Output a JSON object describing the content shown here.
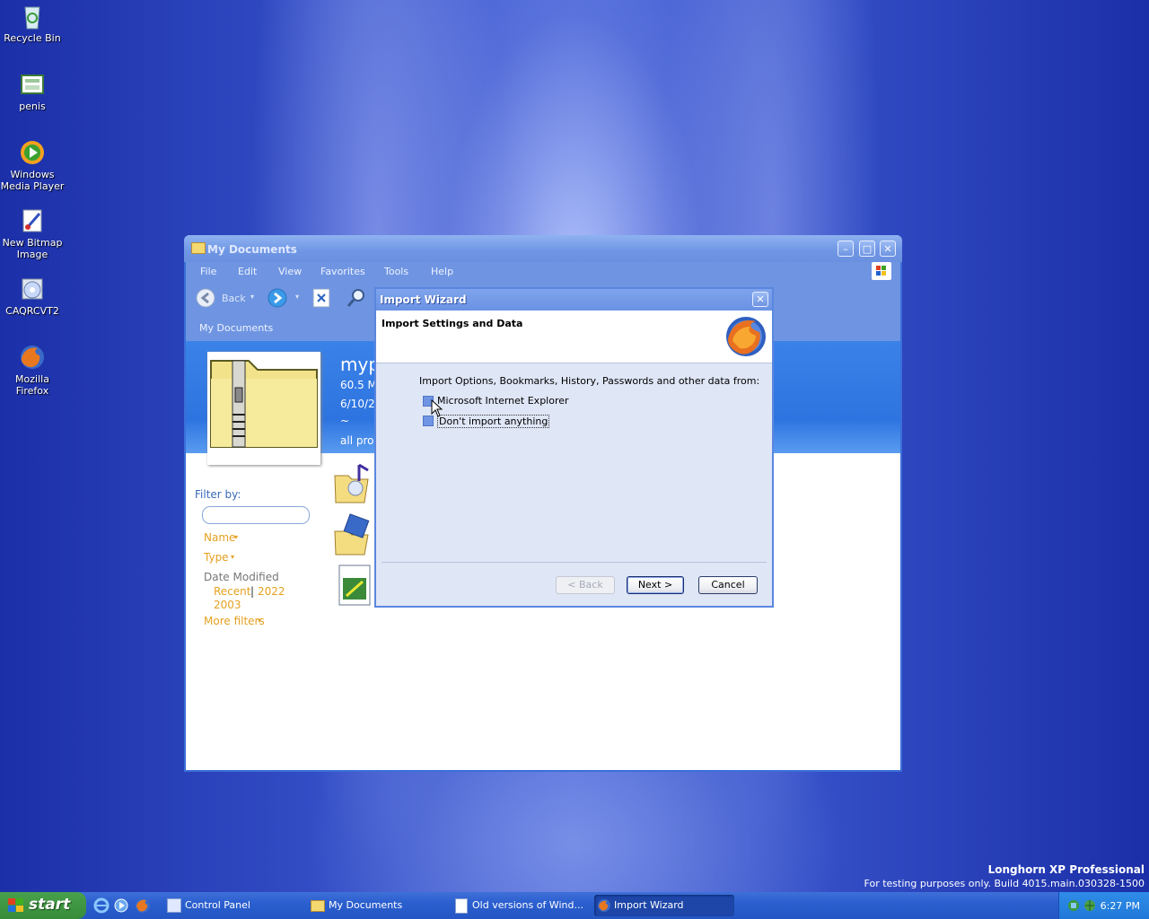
{
  "desktop": {
    "icons": [
      {
        "label": "Recycle Bin"
      },
      {
        "label": "penis"
      },
      {
        "label": "Windows Media Player"
      },
      {
        "label": "New Bitmap Image"
      },
      {
        "label": "CAQRCVT2"
      },
      {
        "label": "Mozilla Firefox"
      }
    ],
    "branding": {
      "edition": "Longhorn XP Professional",
      "build": "For testing purposes only. Build 4015.main.030328-1500"
    }
  },
  "explorer": {
    "title": "My Documents",
    "menu": [
      "File",
      "Edit",
      "View",
      "Favorites",
      "Tools",
      "Help"
    ],
    "toolbar": {
      "back_label": "Back"
    },
    "address": "My Documents",
    "details": {
      "name": "myp",
      "size": "60.5 M",
      "date": "6/10/2",
      "extra": "~",
      "programs": "all prog"
    },
    "filter": {
      "title": "Filter by:",
      "name": "Name",
      "type": "Type",
      "date_modified": "Date Modified",
      "recent": "Recent",
      "sep": "|",
      "y2022": "2022",
      "y2003": "2003",
      "more": "More filters"
    }
  },
  "wizard": {
    "title": "Import Wizard",
    "header": "Import Settings and Data",
    "intro": "Import Options, Bookmarks, History, Passwords and other data from:",
    "options": [
      {
        "label": "Microsoft Internet Explorer"
      },
      {
        "label": "Don't import anything"
      }
    ],
    "buttons": {
      "back": "< Back",
      "next": "Next >",
      "cancel": "Cancel"
    }
  },
  "taskbar": {
    "start": "start",
    "tasks": [
      {
        "label": "Control Panel"
      },
      {
        "label": "My Documents"
      },
      {
        "label": "Old versions of Wind..."
      },
      {
        "label": "Import Wizard"
      }
    ],
    "clock": "6:27 PM"
  }
}
